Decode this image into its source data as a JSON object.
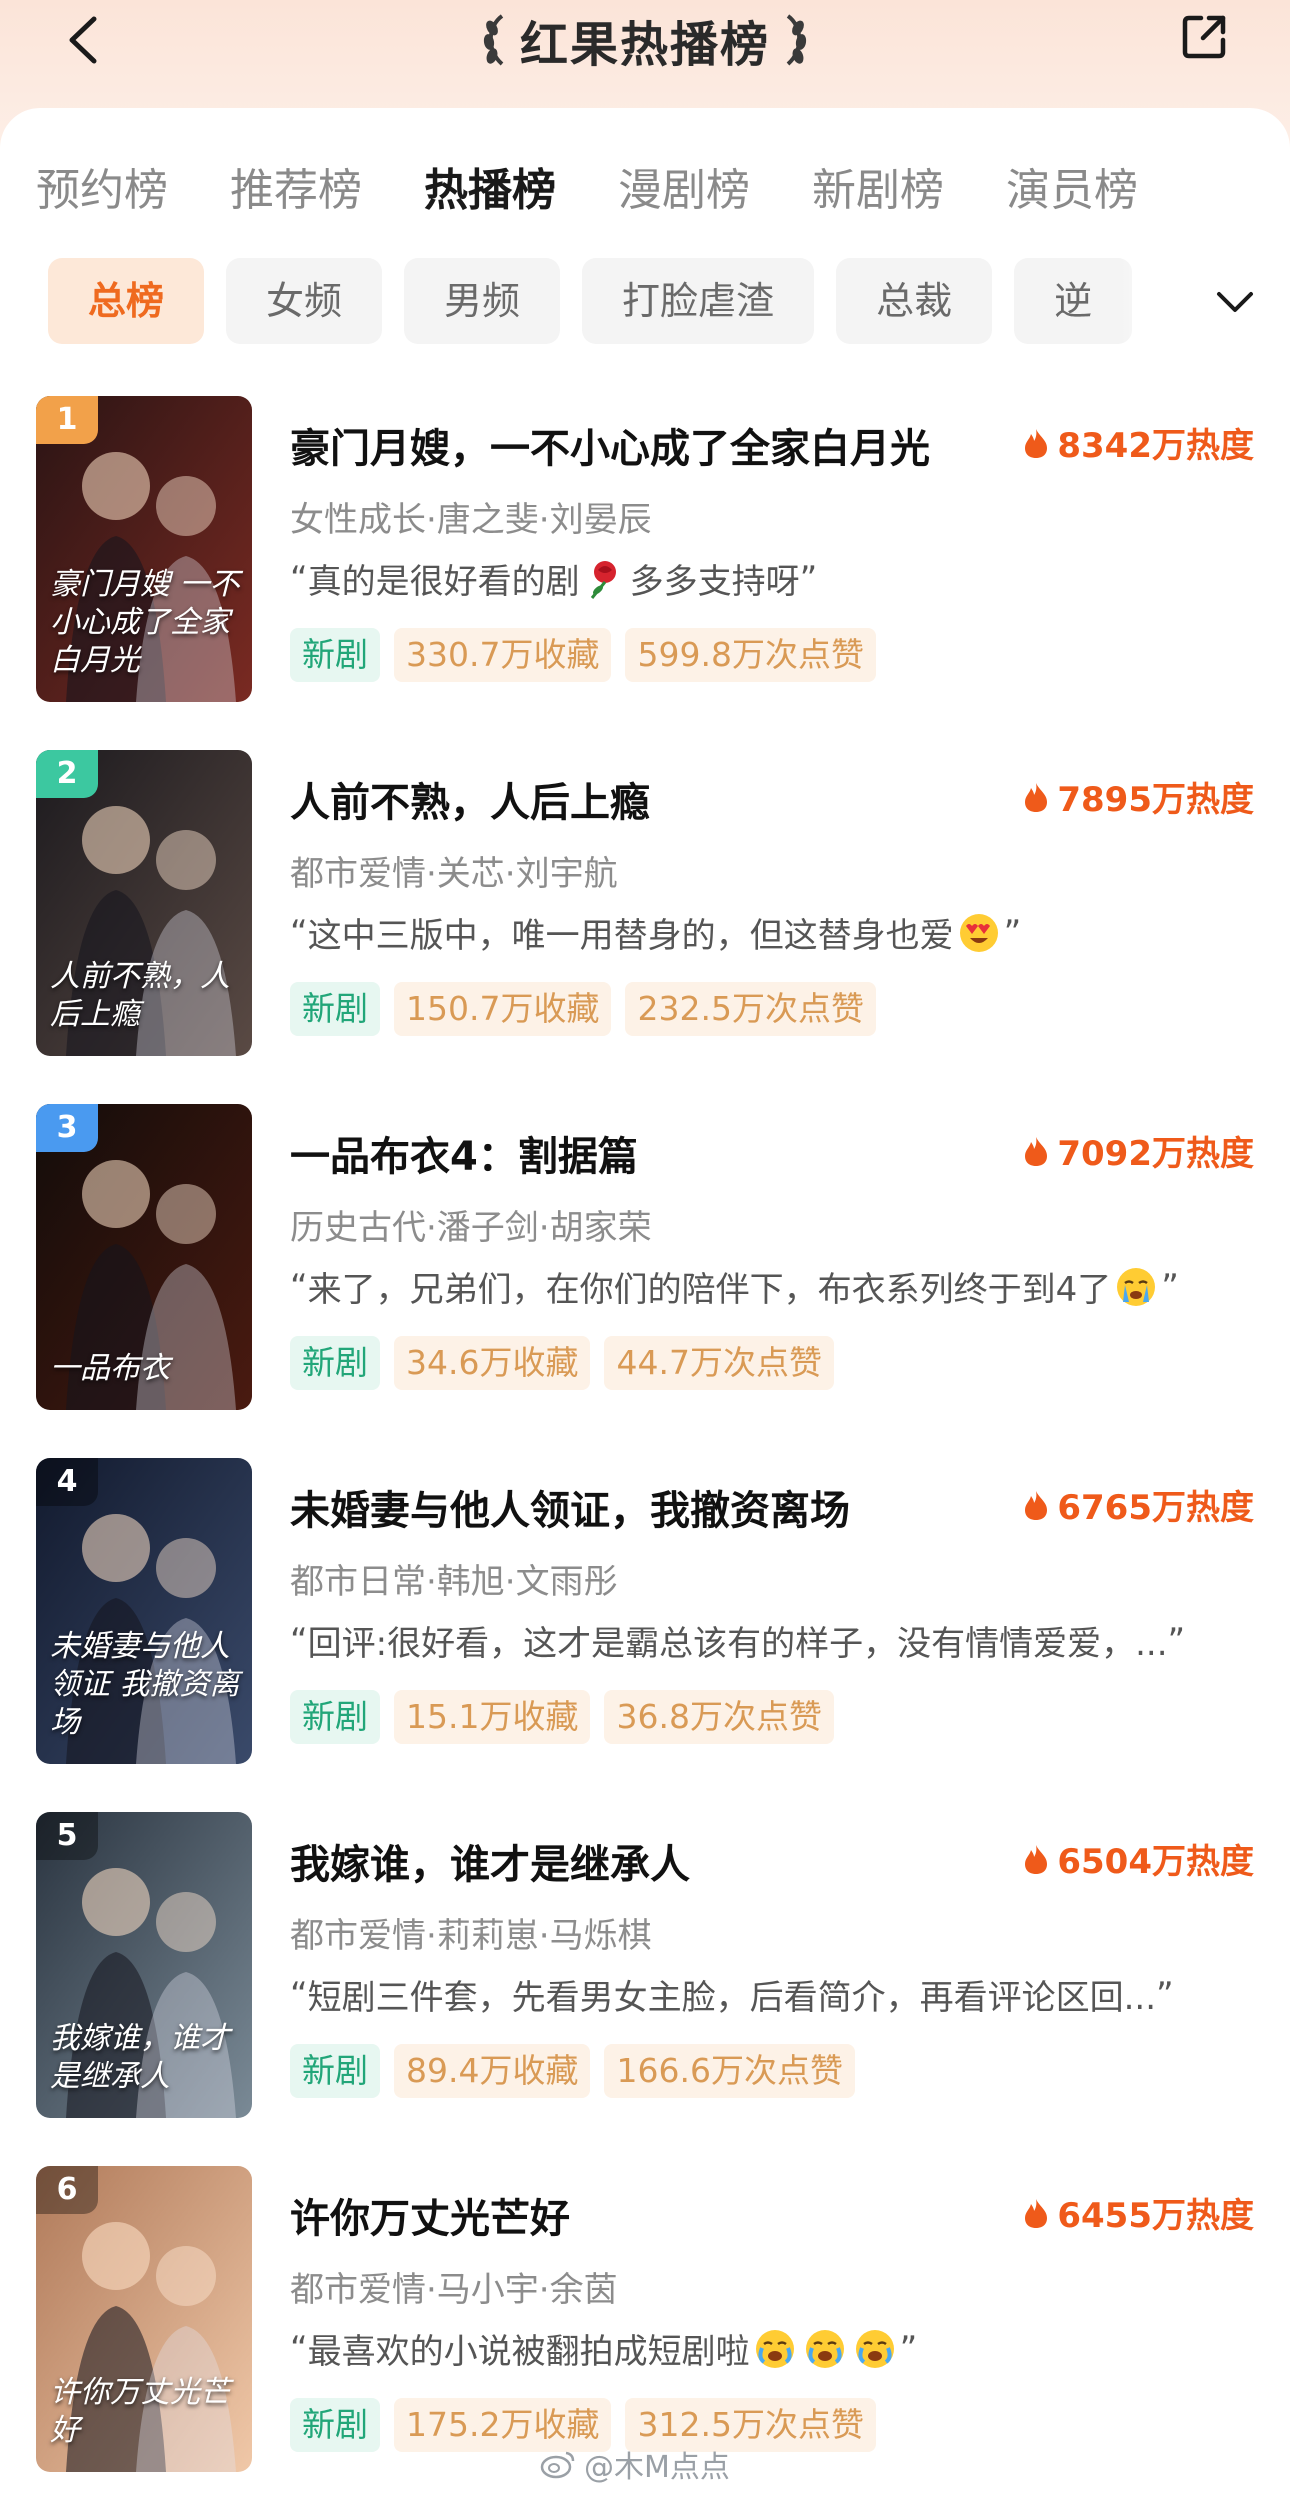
{
  "header": {
    "title": "红果热播榜"
  },
  "tabs": [
    {
      "label": "预约榜"
    },
    {
      "label": "推荐榜"
    },
    {
      "label": "热播榜"
    },
    {
      "label": "漫剧榜"
    },
    {
      "label": "新剧榜"
    },
    {
      "label": "演员榜"
    }
  ],
  "active_tab": "热播榜",
  "chips": [
    {
      "label": "总榜"
    },
    {
      "label": "女频"
    },
    {
      "label": "男频"
    },
    {
      "label": "打脸虐渣"
    },
    {
      "label": "总裁"
    },
    {
      "label": "逆"
    }
  ],
  "active_chip": "总榜",
  "items": [
    {
      "rank": "1",
      "title": "豪门月嫂，一不小心成了全家白月光",
      "heat": "8342万热度",
      "meta": "女性成长·唐之斐·刘晏辰",
      "quote_open": "“",
      "quote_a": "真的是很好看的剧 ",
      "quote_emoji": "rose",
      "quote_b": "多多支持呀",
      "quote_close": "”",
      "tag_new": "新剧",
      "collect": "330.7万收藏",
      "likes": "599.8万次点赞",
      "poster_text": "豪门月嫂 一不小心成了全家白月光",
      "poster_colors": [
        "#2a1414",
        "#7a2a22"
      ],
      "rank_color": "#f2a14a"
    },
    {
      "rank": "2",
      "title": "人前不熟，人后上瘾",
      "heat": "7895万热度",
      "meta": "都市爱情·关芯·刘宇航",
      "quote_open": "“",
      "quote_a": "这中三版中，唯一用替身的，但这替身也爱",
      "quote_emoji": "heart-eyes",
      "quote_b": "",
      "quote_close": "”",
      "tag_new": "新剧",
      "collect": "150.7万收藏",
      "likes": "232.5万次点赞",
      "poster_text": "人前不熟，人后上瘾",
      "poster_colors": [
        "#1c1a1e",
        "#5a4a44"
      ],
      "rank_color": "#3cc8a0"
    },
    {
      "rank": "3",
      "title": "一品布衣4：割据篇",
      "heat": "7092万热度",
      "meta": "历史古代·潘子剑·胡家荣",
      "quote_open": "“",
      "quote_a": "来了，兄弟们，在你们的陪伴下，布衣系列终于到4了",
      "quote_emoji": "crying",
      "quote_b": "",
      "quote_close": "”",
      "tag_new": "新剧",
      "collect": "34.6万收藏",
      "likes": "44.7万次点赞",
      "poster_text": "一品布衣",
      "poster_colors": [
        "#120c0a",
        "#4a1a10"
      ],
      "rank_color": "#4a9af0"
    },
    {
      "rank": "4",
      "title": "未婚妻与他人领证，我撤资离场",
      "heat": "6765万热度",
      "meta": "都市日常·韩旭·文雨彤",
      "quote_open": "“",
      "quote_a": "回评:很好看，这才是霸总该有的样子，没有情情爱爱，...",
      "quote_emoji": "",
      "quote_b": "",
      "quote_close": "”",
      "tag_new": "新剧",
      "collect": "15.1万收藏",
      "likes": "36.8万次点赞",
      "poster_text": "未婚妻与他人领证 我撤资离场",
      "poster_colors": [
        "#121a2e",
        "#3a4a6a"
      ],
      "rank_color": "rgba(0,0,0,0.35)"
    },
    {
      "rank": "5",
      "title": "我嫁谁，谁才是继承人",
      "heat": "6504万热度",
      "meta": "都市爱情·莉莉崽·马烁棋",
      "quote_open": "“",
      "quote_a": "短剧三件套，先看男女主脸，后看简介，再看评论区回...",
      "quote_emoji": "",
      "quote_b": "",
      "quote_close": "”",
      "tag_new": "新剧",
      "collect": "89.4万收藏",
      "likes": "166.6万次点赞",
      "poster_text": "我嫁谁，谁才是继承人",
      "poster_colors": [
        "#2a3440",
        "#7a8a96"
      ],
      "rank_color": "rgba(0,0,0,0.35)"
    },
    {
      "rank": "6",
      "title": "许你万丈光芒好",
      "heat": "6455万热度",
      "meta": "都市爱情·马小宇·余茵",
      "quote_open": "“",
      "quote_a": "最喜欢的小说被翻拍成短剧啦",
      "quote_emoji": "crying3",
      "quote_b": "",
      "quote_close": "”",
      "tag_new": "新剧",
      "collect": "175.2万收藏",
      "likes": "312.5万次点赞",
      "poster_text": "许你万丈光芒好",
      "poster_colors": [
        "#b07a5a",
        "#f0c8a8"
      ],
      "rank_color": "rgba(0,0,0,0.35)"
    }
  ],
  "watermark": "@木M点点",
  "colors": {
    "accent": "#ef6a1f",
    "heat": "#ef5a1a",
    "new_tag": "#22a679",
    "stat_tag": "#d99a55"
  },
  "icons": {
    "back": "chevron-left-icon",
    "share": "share-icon",
    "expand": "chevron-down-icon",
    "heat": "flame-icon"
  }
}
